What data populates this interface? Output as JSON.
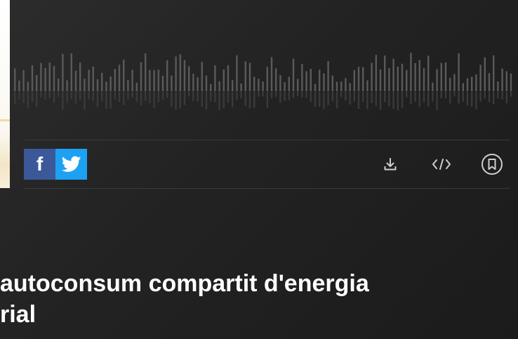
{
  "episode": {
    "title_line1": "autoconsum compartit d'energia",
    "title_line2": "rial"
  },
  "share": {
    "facebook_icon": "facebook-icon",
    "twitter_icon": "twitter-icon",
    "facebook_color": "#3b5998",
    "twitter_color": "#1da1f2"
  },
  "actions": {
    "download_icon": "download-icon",
    "embed_icon": "code-embed-icon",
    "bookmark_icon": "bookmark-icon"
  }
}
